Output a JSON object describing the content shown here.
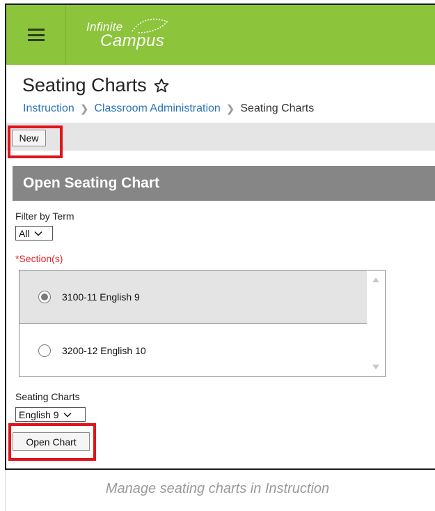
{
  "app": {
    "logo_line1": "Infinite",
    "logo_line2": "Campus"
  },
  "page": {
    "title": "Seating Charts",
    "breadcrumb": [
      "Instruction",
      "Classroom Administration",
      "Seating Charts"
    ]
  },
  "toolbar": {
    "new_label": "New"
  },
  "panel": {
    "title": "Open Seating Chart",
    "filter_label": "Filter by Term",
    "term_value": "All",
    "sections_label": "*Section(s)",
    "sections": [
      {
        "label": "3100-11 English 9",
        "selected": true
      },
      {
        "label": "3200-12 English 10",
        "selected": false
      }
    ],
    "seating_charts_label": "Seating Charts",
    "chart_value": "English 9",
    "open_label": "Open Chart"
  },
  "caption": "Manage seating charts in Instruction",
  "colors": {
    "header_green": "#8cc43c",
    "panel_gray": "#868686",
    "link_blue": "#2b73b6",
    "highlight_red": "#e0151b",
    "required_red": "#e3242b"
  }
}
